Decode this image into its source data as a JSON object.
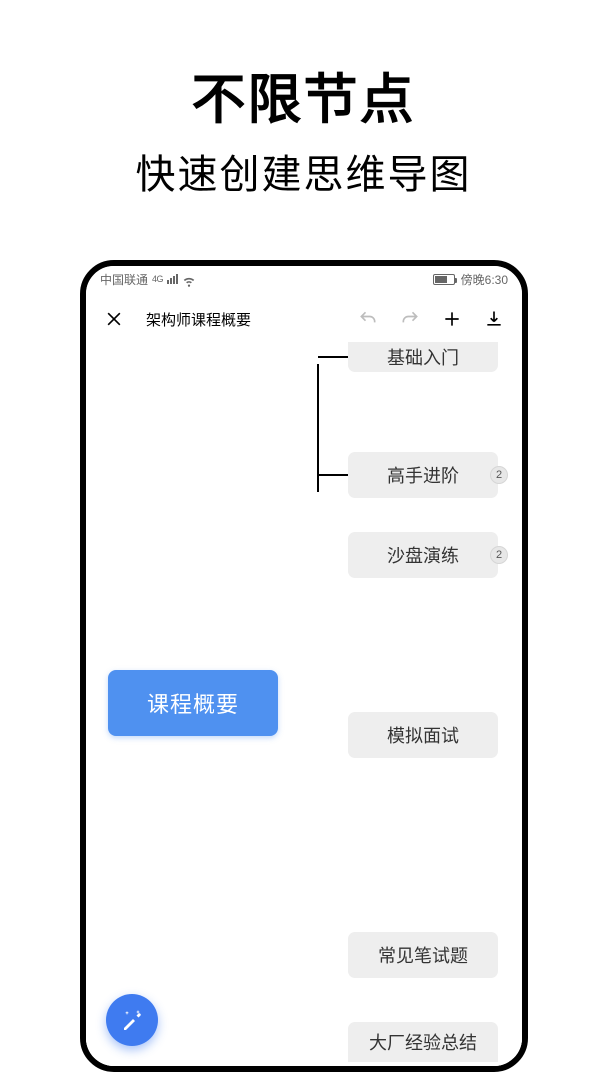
{
  "hero": {
    "title": "不限节点",
    "subtitle": "快速创建思维导图"
  },
  "status": {
    "carrier": "中国联通",
    "network_label": "4G",
    "time": "傍晚6:30"
  },
  "toolbar": {
    "close_icon": "close",
    "title": "架构师课程概要",
    "undo_icon": "undo",
    "redo_icon": "redo",
    "add_icon": "plus",
    "download_icon": "download"
  },
  "mindmap": {
    "root": "课程概要",
    "children": [
      {
        "label": "基础入门",
        "badge": null,
        "partial_top": true
      },
      {
        "label": "高手进阶",
        "badge": "2"
      },
      {
        "label": "沙盘演练",
        "badge": "2"
      },
      {
        "label": "模拟面试",
        "badge": null
      },
      {
        "label": "常见笔试题",
        "badge": null
      },
      {
        "label": "大厂经验总结",
        "badge": null,
        "partial_bottom": true
      }
    ]
  },
  "fab": {
    "icon": "magic-wand"
  }
}
